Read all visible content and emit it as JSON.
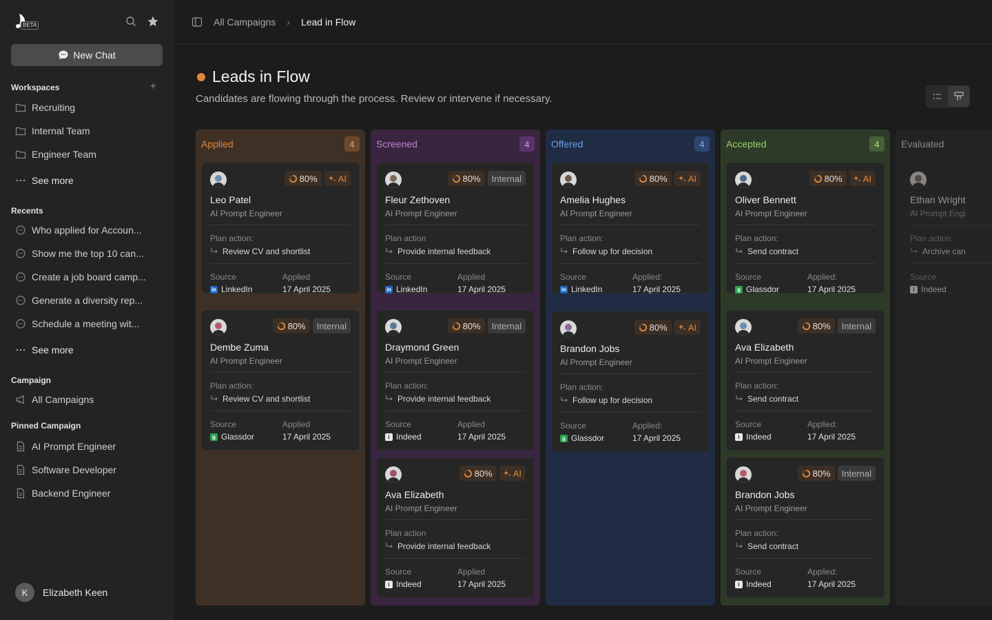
{
  "app": {
    "beta_label": "BETA"
  },
  "sidebar": {
    "new_chat": "New Chat",
    "workspaces_title": "Workspaces",
    "workspaces": [
      "Recruiting",
      "Internal Team",
      "Engineer Team"
    ],
    "see_more": "See more",
    "recents_title": "Recents",
    "recents": [
      "Who applied for Accoun...",
      "Show me the top 10 can...",
      "Create a job board camp...",
      "Generate a diversity rep...",
      "Schedule a meeting wit..."
    ],
    "campaign_title": "Campaign",
    "campaign_item": "All Campaigns",
    "pinned_title": "Pinned Campaign",
    "pinned": [
      "AI Prompt Engineer",
      "Software Developer",
      "Backend Engineer"
    ],
    "user_initial": "K",
    "user_name": "Elizabeth Keen"
  },
  "header": {
    "crumb_parent": "All Campaigns",
    "crumb_current": "Lead in Flow",
    "title": "Leads in Flow",
    "subtitle": "Candidates are flowing through the process. Review or intervene if necessary."
  },
  "columns": [
    {
      "title": "Applied",
      "count": "4",
      "cards": [
        {
          "name": "Leo Patel",
          "role": "AI Prompt Engineer",
          "score": "80%",
          "tag": "AI",
          "plan_label": "Plan action:",
          "plan": "Review CV and shortlist",
          "source_label": "Source",
          "source": "LinkedIn",
          "applied_label": "Applied",
          "applied": "17 April 2025"
        },
        {
          "name": "Dembe Zuma",
          "role": "AI Prompt Engineer",
          "score": "80%",
          "tag": "Internal",
          "plan_label": "Plan action:",
          "plan": "Review CV and shortlist",
          "source_label": "Source",
          "source": "Glassdor",
          "applied_label": "Applied",
          "applied": "17 April 2025"
        }
      ]
    },
    {
      "title": "Screened",
      "count": "4",
      "cards": [
        {
          "name": "Fleur Zethoven",
          "role": "AI Prompt Engineer",
          "score": "80%",
          "tag": "Internal",
          "plan_label": "Plan action",
          "plan": "Provide internal feedback",
          "source_label": "Source",
          "source": "LinkedIn",
          "applied_label": "Applied",
          "applied": "17 April 2025"
        },
        {
          "name": "Draymond Green",
          "role": "AI Prompt Engineer",
          "score": "80%",
          "tag": "Internal",
          "plan_label": "Plan action:",
          "plan": "Provide internal feedback",
          "source_label": "Source",
          "source": "Indeed",
          "applied_label": "Applied",
          "applied": "17 April 2025"
        },
        {
          "name": "Ava Elizabeth",
          "role": "AI Prompt Engineer",
          "score": "80%",
          "tag": "AI",
          "plan_label": "Plan action",
          "plan": "Provide internal feedback",
          "source_label": "Source",
          "source": "Indeed",
          "applied_label": "Applied",
          "applied": "17 April 2025"
        }
      ]
    },
    {
      "title": "Offered",
      "count": "4",
      "cards": [
        {
          "name": "Amelia Hughes",
          "role": "AI Prompt Engineer",
          "score": "80%",
          "tag": "AI",
          "plan_label": "Plan action:",
          "plan": "Follow up for decision",
          "source_label": "Source",
          "source": "LinkedIn",
          "applied_label": "Applied:",
          "applied": "17 April 2025"
        },
        {
          "name": "Brandon Jobs",
          "role": "AI Prompt Engineer",
          "score": "80%",
          "tag": "AI",
          "plan_label": "Plan action:",
          "plan": "Follow up for decision",
          "source_label": "Source",
          "source": "Glassdor",
          "applied_label": "Applied:",
          "applied": "17 April 2025"
        }
      ]
    },
    {
      "title": "Accepted",
      "count": "4",
      "cards": [
        {
          "name": "Oliver Bennett",
          "role": "AI Prompt Engineer",
          "score": "80%",
          "tag": "AI",
          "plan_label": "Plan action:",
          "plan": "Send contract",
          "source_label": "Source",
          "source": "Glassdor",
          "applied_label": "Applied:",
          "applied": "17 April 2025"
        },
        {
          "name": "Ava Elizabeth",
          "role": "AI Prompt Engineer",
          "score": "80%",
          "tag": "Internal",
          "plan_label": "Plan action:",
          "plan": "Send contract",
          "source_label": "Source",
          "source": "Indeed",
          "applied_label": "Applied:",
          "applied": "17 April 2025"
        },
        {
          "name": "Brandon Jobs",
          "role": "AI Prompt Engineer",
          "score": "80%",
          "tag": "Internal",
          "plan_label": "Plan action:",
          "plan": "Send contract",
          "source_label": "Source",
          "source": "Indeed",
          "applied_label": "Applied:",
          "applied": "17 April 2025"
        }
      ]
    },
    {
      "title": "Evaluated",
      "cards": [
        {
          "name": "Ethan Wright",
          "role": "AI Prompt Engi",
          "plan_label": "Plan action:",
          "plan": "Archive can",
          "source_label": "Source",
          "source": "Indeed"
        }
      ]
    }
  ],
  "colors": {
    "accent": "#e0883a",
    "applied": "#3f3026",
    "screened": "#3a2540",
    "offered": "#1f2c44",
    "accepted": "#2d3a28"
  }
}
